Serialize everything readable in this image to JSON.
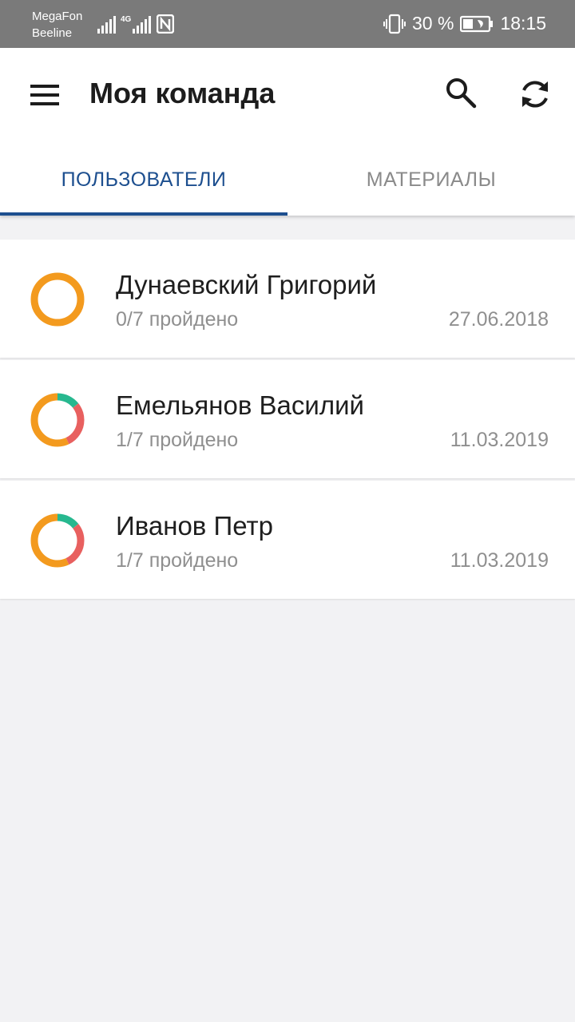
{
  "status_bar": {
    "carrier_1": "MegaFon",
    "carrier_2": "Beeline",
    "network_type": "4G",
    "battery_percent": "30 %",
    "time": "18:15"
  },
  "app_bar": {
    "title": "Моя команда",
    "menu_icon": "hamburger-menu-icon",
    "search_icon": "search-icon",
    "refresh_icon": "refresh-icon"
  },
  "tabs": [
    {
      "label": "ПОЛЬЗОВАТЕЛИ",
      "active": true
    },
    {
      "label": "МАТЕРИАЛЫ",
      "active": false
    }
  ],
  "users": [
    {
      "name": "Дунаевский Григорий",
      "progress": "0/7 пройдено",
      "date": "27.06.2018",
      "ring": {
        "completed": 0,
        "failed": 0,
        "total": 7
      }
    },
    {
      "name": "Емельянов Василий",
      "progress": "1/7 пройдено",
      "date": "11.03.2019",
      "ring": {
        "completed": 1,
        "failed": 2,
        "total": 7
      }
    },
    {
      "name": "Иванов Петр",
      "progress": "1/7 пройдено",
      "date": "11.03.2019",
      "ring": {
        "completed": 1,
        "failed": 2,
        "total": 7
      }
    }
  ],
  "colors": {
    "status_bar": "#7a7a7a",
    "accent": "#1d4f8f",
    "ring_pending": "#f39a1e",
    "ring_completed": "#27b88f",
    "ring_failed": "#e8605f"
  }
}
